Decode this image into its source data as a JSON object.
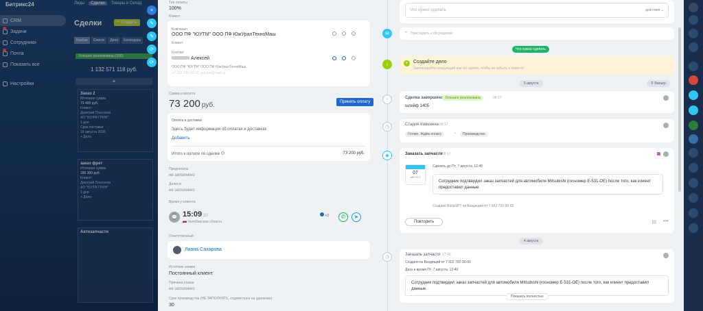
{
  "app": {
    "brand": "Битрикс24"
  },
  "topnav": [
    "Лиды",
    "Сделки",
    "Товары и Склад"
  ],
  "sidebar": [
    {
      "label": "CRM",
      "active": true
    },
    {
      "label": "Задачи",
      "badge": true
    },
    {
      "label": "Сотрудники"
    },
    {
      "label": "Почта",
      "badge": true
    },
    {
      "label": "Показать все"
    },
    {
      "label": "Настройки"
    }
  ],
  "kanban": {
    "title": "Сделки",
    "create": "+ Создать",
    "views": [
      "Канбан",
      "Список",
      "Дела",
      "Календарь"
    ],
    "stage": "Успешно реализованы (100)",
    "sum": "1 132 571 118 руб.",
    "plus": "+",
    "cards": [
      {
        "title": "Заказ 2",
        "l1": "Итоговая сумма",
        "l2": "73 400 руб.",
        "l3": "Клиент",
        "l4": "Дмитрий Платонов",
        "l5": "АО \"ЮУРК ГРИН\"",
        "l6": "1 дня",
        "l7": "Срок поставки",
        "l8": "16 августа 2026",
        "foot": "+ Дело"
      },
      {
        "title": "заказ фрет",
        "l1": "Итоговая сумма",
        "l2": "185 300 руб.",
        "l3": "Клиент",
        "l4": "Дмитрий Платонов",
        "l5": "АО \"ЮУРК ГРИН\"",
        "l6": "1 дня",
        "l7": "",
        "l8": "",
        "foot": "+ Дело"
      },
      {
        "title": "Автозапчасти",
        "l1": "",
        "l2": "",
        "l3": "",
        "l4": "",
        "l5": "",
        "l6": "",
        "l7": "",
        "l8": "",
        "foot": ""
      }
    ]
  },
  "side_buttons": [
    "×",
    "✎",
    "✎",
    "⟳",
    "⟳"
  ],
  "deal": {
    "pay_type_label": "Тип оплаты",
    "pay_type": "100%",
    "client_label": "Клиент",
    "company_label": "Компания",
    "company": "ООО ПФ \"ЮУТМ\" ООО ПФ ЮжУралТехноМаш",
    "company_role": "Клиент",
    "contact_label": "Контакт",
    "contact": "Алексей",
    "contact_company": "ООО ПФ \"ЮУТМ\" ООО ПФ ЮжУралТехноМаш",
    "contact_info": "+7 922 700-00-00, publish@mail.ru",
    "amount_label": "Сумма и валюта",
    "amount": "73 200",
    "currency": "руб.",
    "accept_pay": "Принять оплату",
    "pay_ship_title": "Оплата и доставка",
    "pay_ship_text": "Здесь будет информация об оплатах и доставках",
    "pay_ship_add": "Добавить",
    "total_label": "Итого к оплате по сделке",
    "total": "73 200 руб.",
    "prepay_label": "Предоплата",
    "prepay": "не заполнено",
    "debt_label": "Долги и",
    "debt": "не заполнено",
    "client_time_label": "Время у клиента",
    "client_time": "15:09",
    "client_time_sec": ":10",
    "region": "Челябинская область",
    "messengers_more": "+2",
    "resp_label": "Ответственный",
    "resp": "Лиана Сахарова",
    "source_label": "Источник заявки",
    "source": "Постоянный клиент",
    "refuse_label": "Причина отказа",
    "refuse": "не заполнено",
    "term_label": "Срок производства (НЕ ЗАПОЛНЯТЬ, отдаем поле на удаление)",
    "term": "30"
  },
  "timeline": {
    "todo_placeholder": "Что нужно сделать",
    "todo_action": "действия",
    "comment_placeholder": "Присоедить к обсуждению",
    "need_todo": "Что нужно сделать",
    "create_title": "Создайте дело",
    "create_text": "Запланируйте следующий шаг по сделке, чтобы не забыть о клиенте",
    "date1": "5 августа",
    "filter": "Фильтр",
    "ev1_title": "Сделка завершена",
    "ev1_tag": "Успешно реализована",
    "ev1_time": "08:17",
    "ev1_text": "шлейф 1405",
    "ev2_title": "Стадия изменена",
    "ev2_time": "08:17",
    "ev2_from": "Готово. Ждём оплату",
    "ev2_to": "Производство",
    "ev3_title": "Заказать запчасти",
    "ev3_time": "08:17",
    "ev3_cal_month": "АВГУСТ",
    "ev3_cal_day": "07",
    "ev3_done": "Сделать до Пт, 7 августа, 12:49",
    "ev3_text": "Сотрудник подтвердил заказ запчастей для автомобиля Mitsubishi (госномер E-531-OE) после того, как клиент предоставил данные.",
    "ev3_source": "Создано BitrixGPT из Входящий от 7 922 792-90-00",
    "ev3_repeat": "Повторить",
    "date2": "4 августа",
    "ev4_title": "Заказать запчасти",
    "ev4_time": "17:49",
    "ev4_created": "Создано из Входящий от 7 922 792-90-00",
    "ev4_date": "Дата и время Пт, 7 августа, 12:49",
    "ev4_text": "Сотрудник подтвердил заказ запчастей для автомобиля Mitsubishi (госномер E-531-OE) после того, как клиент предоставил данные.",
    "ev4_more": "Показать полностью"
  },
  "colors": {
    "accent": "#2067b0",
    "green": "#9dcf00",
    "success": "#589309"
  }
}
